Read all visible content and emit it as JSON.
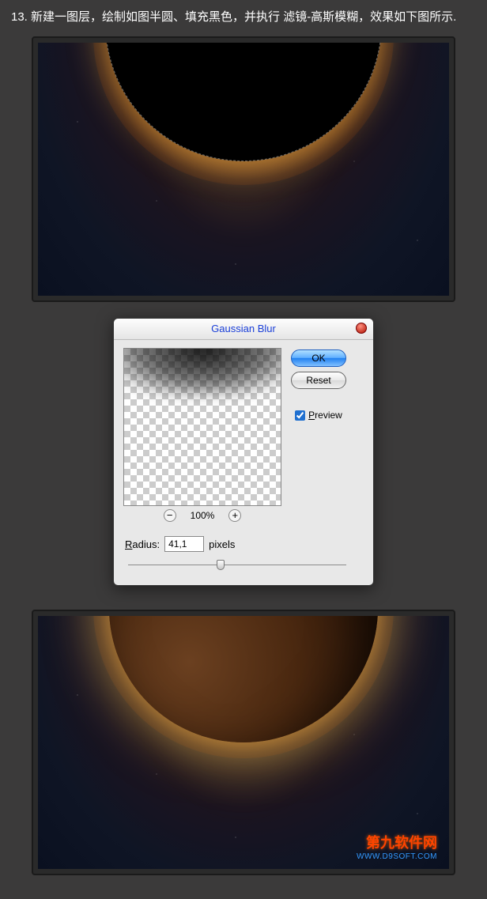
{
  "step": {
    "text": "13. 新建一图层，绘制如图半圆、填充黑色，并执行 滤镜-高斯模糊，效果如下图所示."
  },
  "dialog": {
    "title": "Gaussian Blur",
    "ok_label": "OK",
    "reset_label": "Reset",
    "preview_label_underline": "P",
    "preview_label_rest": "review",
    "preview_checked": true,
    "zoom": {
      "minus": "−",
      "percent": "100%",
      "plus": "+"
    },
    "radius": {
      "label_underline": "R",
      "label_rest": "adius:",
      "value": "41,1",
      "unit": "pixels"
    }
  },
  "watermark": {
    "title": "第九软件网",
    "url": "WWW.D9SOFT.COM"
  }
}
